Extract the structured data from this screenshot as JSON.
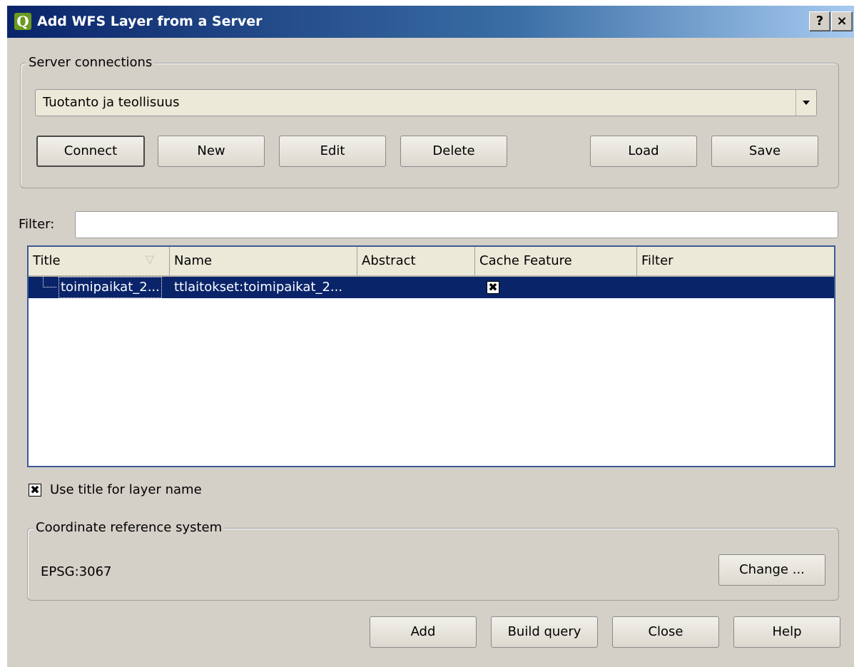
{
  "window": {
    "title": "Add WFS Layer from a Server",
    "help_button": "?",
    "close_button": "×"
  },
  "server_connections": {
    "group_label": "Server connections",
    "selected_connection": "Tuotanto ja teollisuus",
    "buttons": {
      "connect": "Connect",
      "new": "New",
      "edit": "Edit",
      "delete": "Delete",
      "load": "Load",
      "save": "Save"
    }
  },
  "filter": {
    "label": "Filter:",
    "value": ""
  },
  "layers_table": {
    "columns": [
      "Title",
      "Name",
      "Abstract",
      "Cache Feature",
      "Filter"
    ],
    "rows": [
      {
        "title": "toimipaikat_2...",
        "name": "ttlaitokset:toimipaikat_2...",
        "abstract": "",
        "cache_feature": "✖",
        "filter": ""
      }
    ]
  },
  "use_title_for_layer_name": {
    "checked_mark": "✖",
    "label": "Use title for layer name"
  },
  "crs": {
    "group_label": "Coordinate reference system",
    "value": "EPSG:3067",
    "change_button": "Change ..."
  },
  "footer_buttons": {
    "add": "Add",
    "build_query": "Build query",
    "close": "Close",
    "help": "Help"
  }
}
